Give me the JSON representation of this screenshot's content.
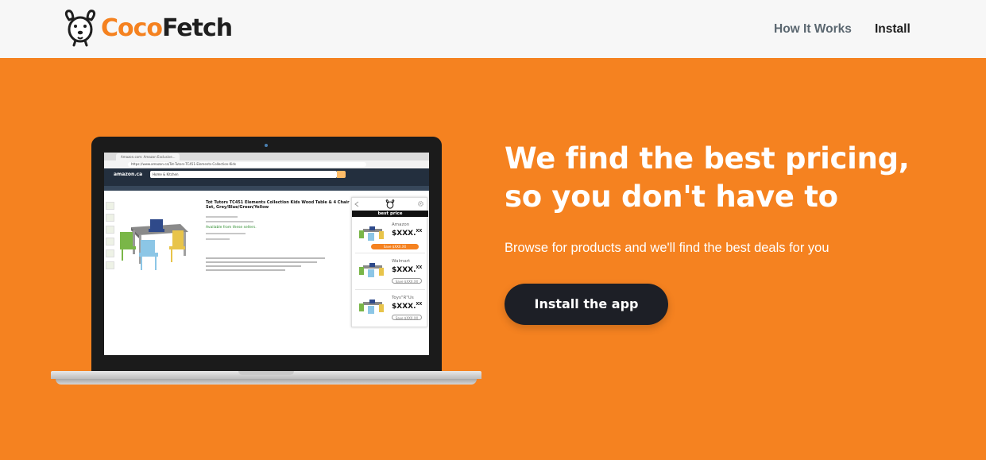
{
  "nav": {
    "brand_part1": "Coco",
    "brand_part2": "Fetch",
    "links": [
      "How It Works",
      "Install"
    ]
  },
  "hero": {
    "headline": "We find the best pricing, so you don't have to",
    "subheadline": "Browse for products and we'll find the best deals for you",
    "cta_label": "Install the app"
  },
  "mockup": {
    "browser_tab": "Amazon.com: Amazon Exclusive...",
    "url": "https://www.amazon.ca/Tot-Tutors-TC451-Elements-Collection-Kids",
    "site_logo": "amazon.ca",
    "search_category": "Home & Kitchen",
    "product_title": "Tot Tutors TC451 Elements Collection Kids Wood Table & 4 Chair Set, Grey/Blue/Green/Yellow",
    "availability": "Available from these sellers.",
    "extension_title": "best price",
    "offers": [
      {
        "store": "Amazon",
        "price": "$XXX.",
        "cents": "XX",
        "save": "Save $XXX.XX"
      },
      {
        "store": "Walmart",
        "price": "$XXX.",
        "cents": "XX",
        "save": "Save $XXX.XX"
      },
      {
        "store": "Toys\"R\"Us",
        "price": "$XXX.",
        "cents": "XX",
        "save": "Save $XXX.XX"
      }
    ]
  },
  "colors": {
    "accent": "#f58220",
    "nav_bg": "#f7f7f7",
    "cta_bg": "#1d1f26"
  },
  "icons": [
    "dog-logo-icon",
    "settings-gear-icon",
    "back-arrow-icon"
  ]
}
